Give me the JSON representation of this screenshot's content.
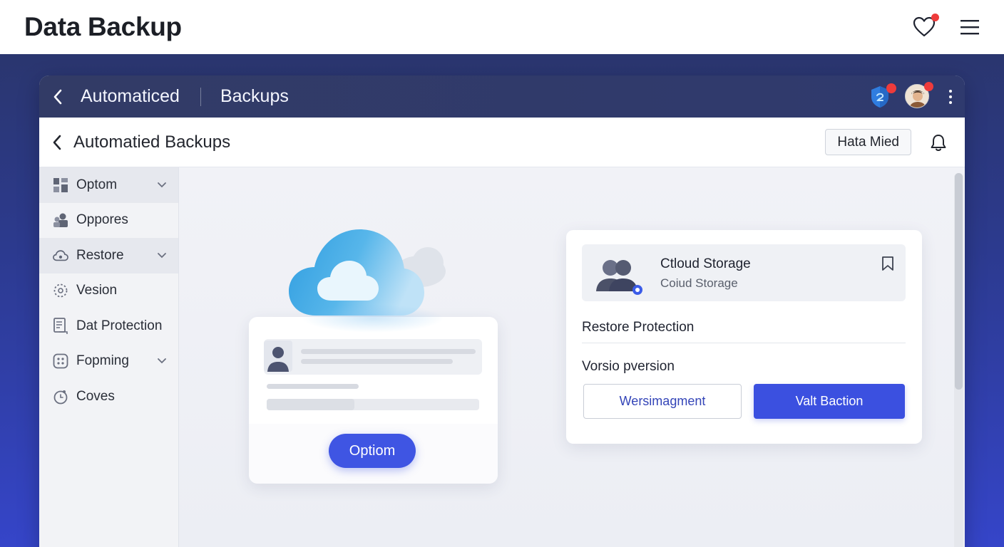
{
  "page": {
    "title": "Data Backup"
  },
  "window": {
    "breadcrumb": {
      "first": "Automaticed",
      "second": "Backups"
    }
  },
  "subheader": {
    "title": "Automatied Backups",
    "action_button": "Hata Mied"
  },
  "sidebar": {
    "items": [
      {
        "label": "Optom",
        "icon": "grid-icon",
        "has_chevron": true,
        "shaded": true
      },
      {
        "label": "Oppores",
        "icon": "users-icon",
        "has_chevron": false,
        "shaded": false
      },
      {
        "label": "Restore",
        "icon": "cloud-icon",
        "has_chevron": true,
        "shaded": true
      },
      {
        "label": "Vesion",
        "icon": "version-icon",
        "has_chevron": false,
        "shaded": false
      },
      {
        "label": "Dat Protection",
        "icon": "document-icon",
        "has_chevron": false,
        "shaded": false
      },
      {
        "label": "Fopming",
        "icon": "dots-grid-icon",
        "has_chevron": true,
        "shaded": false
      },
      {
        "label": "Coves",
        "icon": "clock-icon",
        "has_chevron": false,
        "shaded": false
      }
    ]
  },
  "illustration": {
    "button_label": "Optiom"
  },
  "storage_card": {
    "storage_title": "Ctloud Storage",
    "storage_subtitle": "Coiud Storage",
    "restore_protection": "Restore Protection",
    "version_label": "Vorsio pversion",
    "outline_button": "Wersimagment",
    "solid_button": "Valt Baction"
  },
  "colors": {
    "accent": "#3b50e0",
    "window_bar": "#323b66",
    "notification": "#ee3b3b",
    "cloud": "#3fa9e8"
  }
}
